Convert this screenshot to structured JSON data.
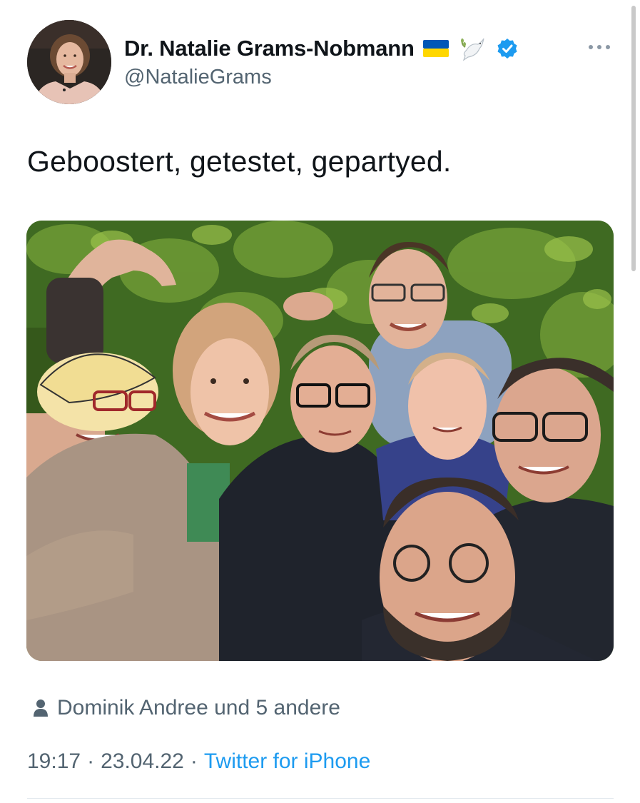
{
  "tweet": {
    "author": {
      "display_name": "Dr. Natalie Grams-Nobmann",
      "handle": "@NatalieGrams",
      "verified": true,
      "name_emojis": [
        "ukraine-flag-icon",
        "dove-icon"
      ],
      "avatar_icon": "avatar"
    },
    "more_icon": "more-icon",
    "text": "Geboostert, getestet, gepartyed.",
    "media": {
      "type": "photo",
      "icon": "group-selfie-photo"
    },
    "likes": {
      "icon": "person-icon",
      "label": "Dominik Andree und 5 andere"
    },
    "meta": {
      "time": "19:17",
      "date": "23.04.22",
      "separator": "·",
      "source": "Twitter for iPhone"
    }
  },
  "colors": {
    "text_primary": "#0f1419",
    "text_secondary": "#536471",
    "link": "#1d9bf0",
    "verified": "#1d9bf0",
    "ukraine_blue": "#0057b7",
    "ukraine_yellow": "#ffd700"
  }
}
